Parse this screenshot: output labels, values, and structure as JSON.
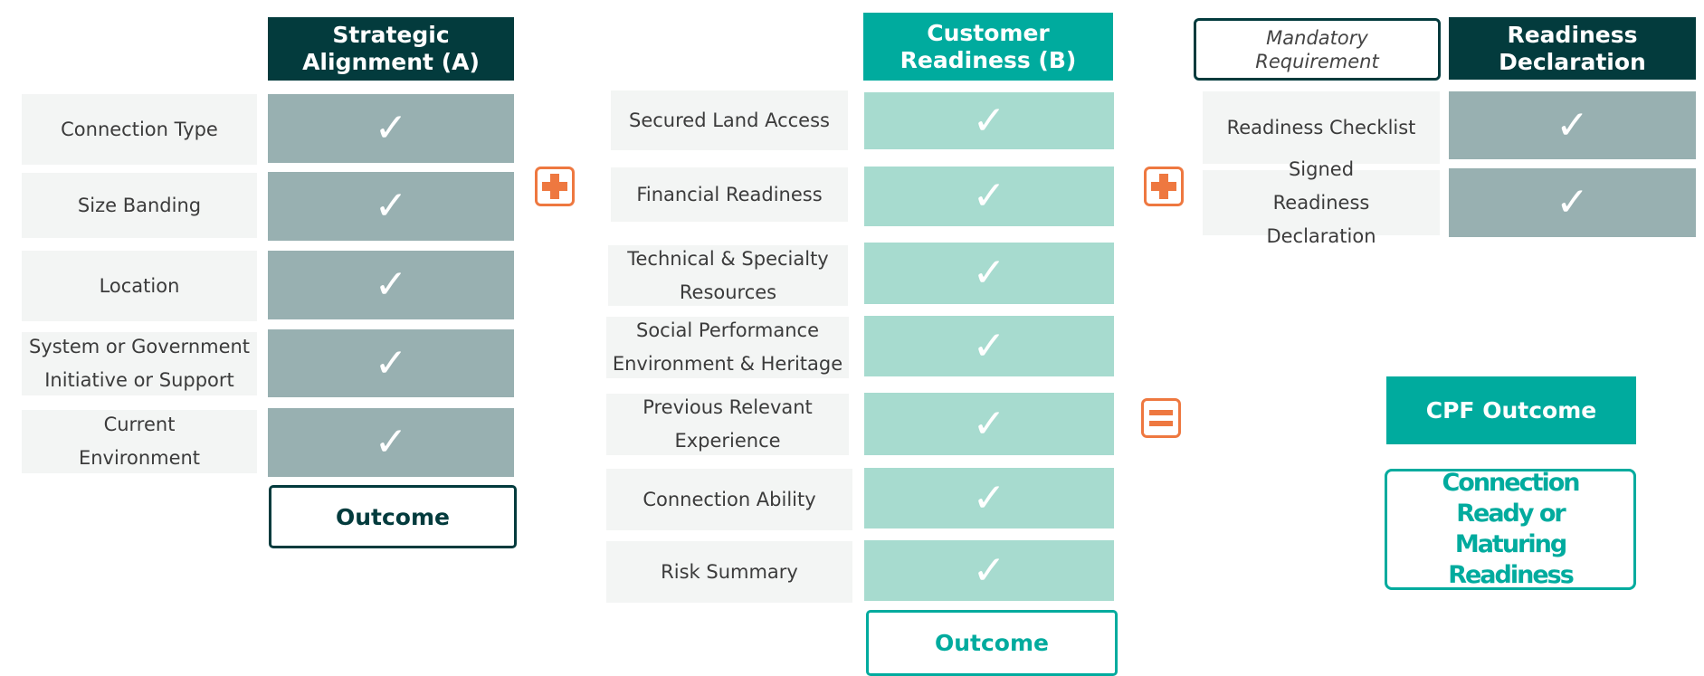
{
  "colors": {
    "dark_teal": "#033b3d",
    "teal": "#00ab9e",
    "grey_check": "#98b0b1",
    "mint_check": "#a7dbcf",
    "label_bg": "#f3f5f4",
    "operator_orange": "#ee7840"
  },
  "check_glyph": "✓",
  "column_a": {
    "header": "Strategic Alignment (A)",
    "rows": [
      "Connection Type",
      "Size Banding",
      "Location",
      "System or Government Initiative or Support",
      "Current Environment"
    ],
    "outcome": "Outcome"
  },
  "operator_1": {
    "icon": "plus-icon"
  },
  "column_b": {
    "header": "Customer Readiness (B)",
    "rows": [
      "Secured Land Access",
      "Financial Readiness",
      "Technical & Specialty Resources",
      "Social Performance Environment & Heritage",
      "Previous Relevant Experience",
      "Connection Ability",
      "Risk Summary"
    ],
    "outcome": "Outcome"
  },
  "operator_2": {
    "icon": "plus-icon"
  },
  "column_c": {
    "mandatory_label": "Mandatory Requirement",
    "header": "Readiness Declaration",
    "rows": [
      "Readiness Checklist",
      "Signed Readiness Declaration"
    ]
  },
  "operator_3": {
    "icon": "equals-icon"
  },
  "result": {
    "title": "CPF Outcome",
    "value": "Connection Ready or Maturing Readiness"
  }
}
